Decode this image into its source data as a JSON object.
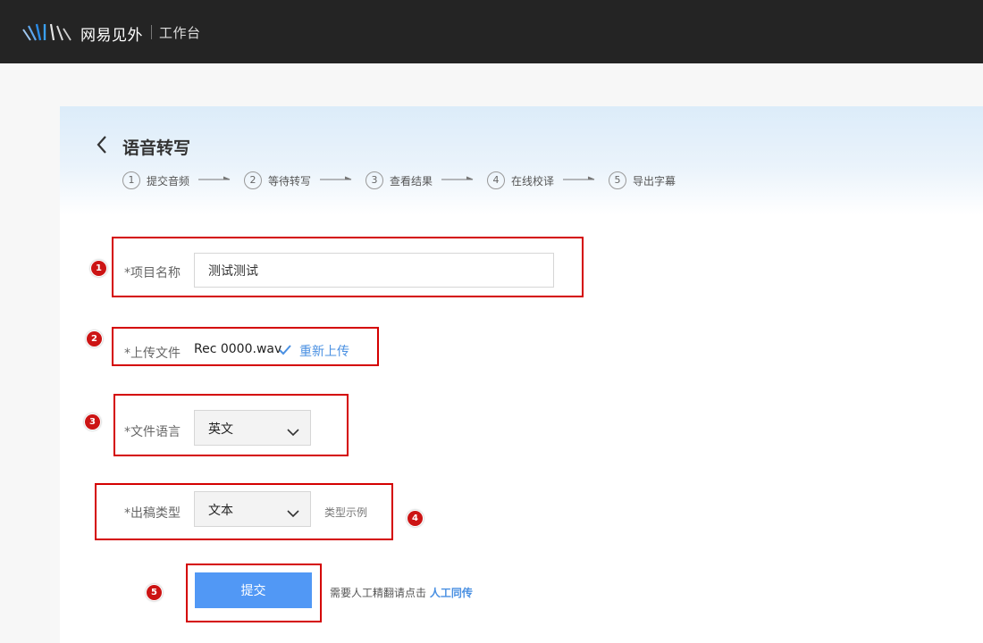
{
  "header": {
    "brand": "网易见外",
    "workspace": "工作台"
  },
  "page": {
    "title": "语音转写"
  },
  "steps": [
    {
      "num": "1",
      "label": "提交音频"
    },
    {
      "num": "2",
      "label": "等待转写"
    },
    {
      "num": "3",
      "label": "查看结果"
    },
    {
      "num": "4",
      "label": "在线校译"
    },
    {
      "num": "5",
      "label": "导出字幕"
    }
  ],
  "form": {
    "project_name_label": "*项目名称",
    "project_name_value": "测试测试",
    "upload_label": "*上传文件",
    "file_name": "Rec 0000.wav",
    "reupload": "重新上传",
    "language_label": "*文件语言",
    "language_value": "英文",
    "output_type_label": "*出稿类型",
    "output_type_value": "文本",
    "type_example": "类型示例",
    "submit": "提交",
    "hint_text": "需要人工精翻请点击 ",
    "hint_link": "人工同传"
  },
  "annotations": [
    "1",
    "2",
    "3",
    "4",
    "5"
  ],
  "colors": {
    "topbar": "#242424",
    "accent": "#5198f5",
    "link": "#4a90e2",
    "annotation": "#d40000"
  }
}
